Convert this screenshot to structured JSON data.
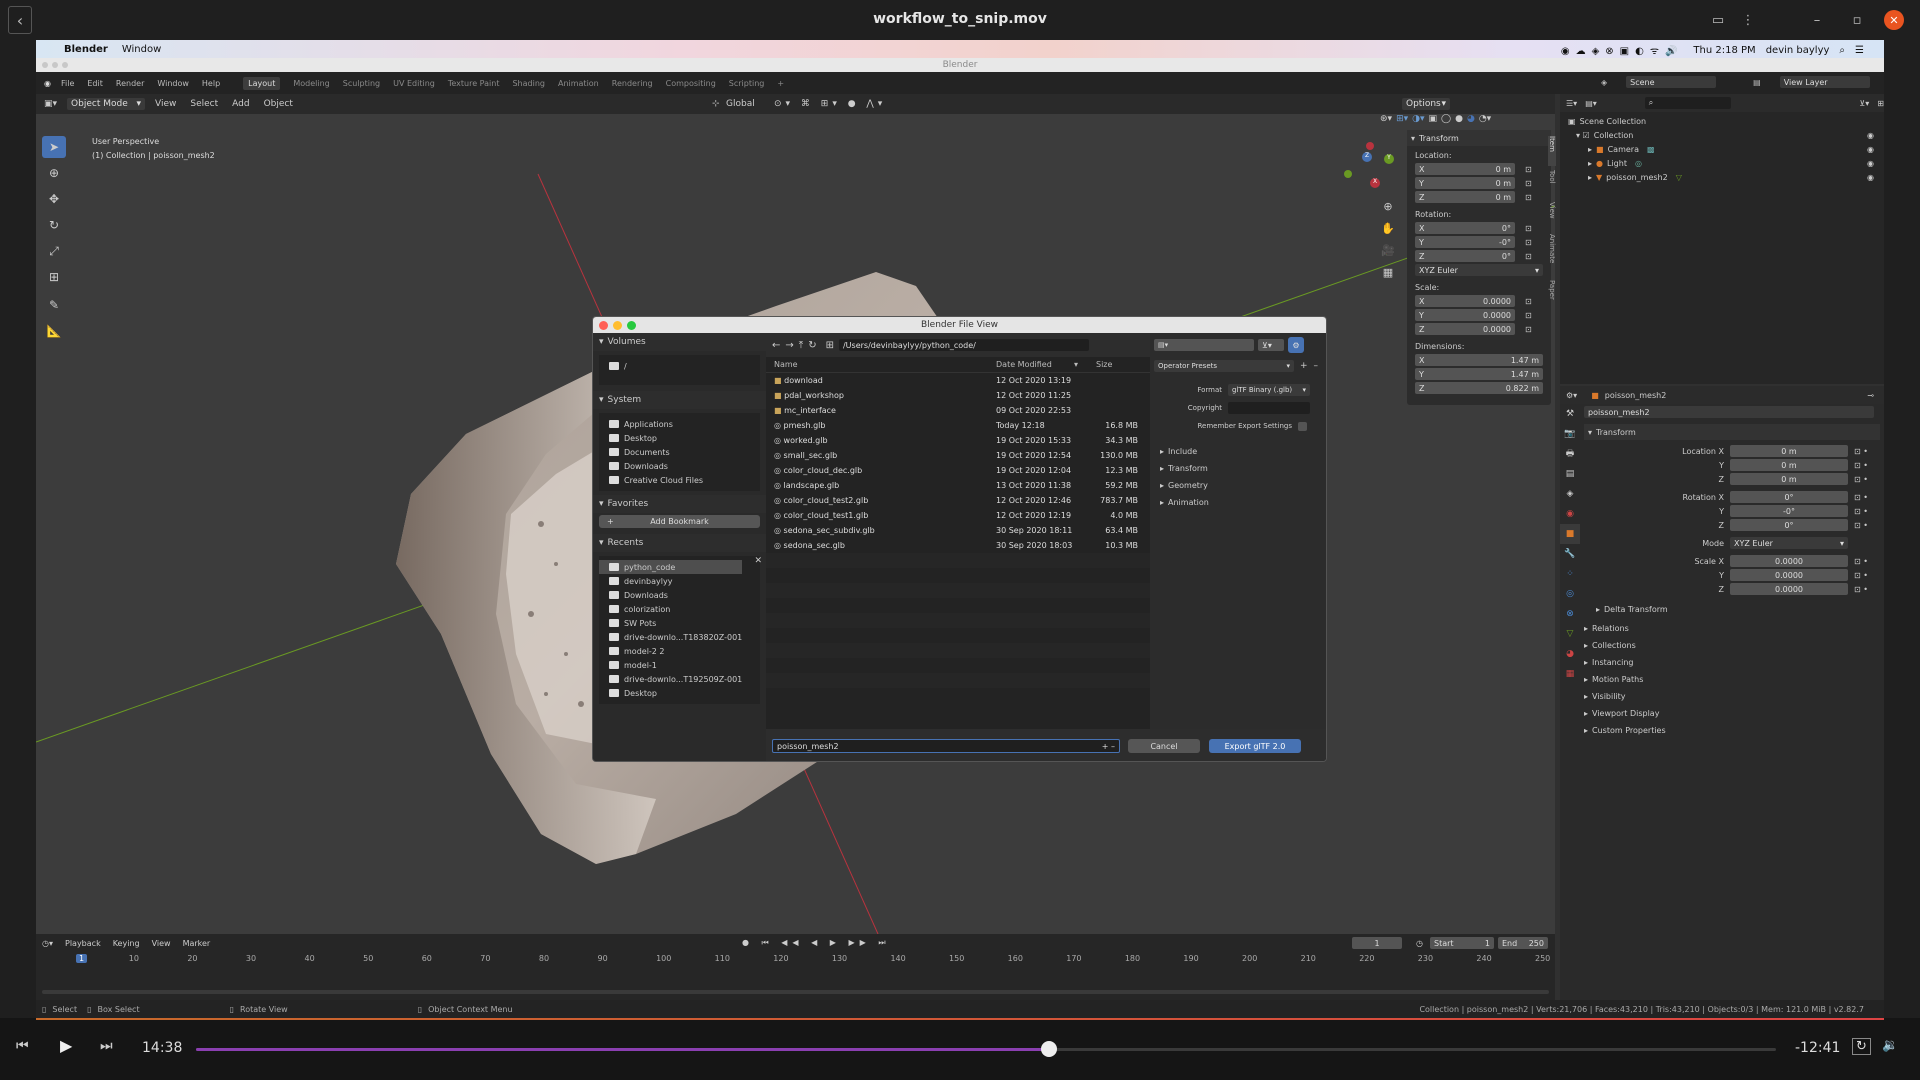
{
  "video": {
    "title": "workflow_to_snip.mov",
    "current_time": "14:38",
    "remaining_time": "-12:41",
    "progress": 0.54
  },
  "mac_menubar": {
    "app": "Blender",
    "menu": [
      "Window"
    ],
    "clock": "Thu 2:18 PM",
    "user": "devin baylyy"
  },
  "blender": {
    "window_title": "Blender",
    "menus": [
      "File",
      "Edit",
      "Render",
      "Window",
      "Help"
    ],
    "workspaces": [
      "Layout",
      "Modeling",
      "Sculpting",
      "UV Editing",
      "Texture Paint",
      "Shading",
      "Animation",
      "Rendering",
      "Compositing",
      "Scripting",
      "+"
    ],
    "active_workspace": "Layout",
    "scene": "Scene",
    "view_layer": "View Layer",
    "viewport": {
      "mode": "Object Mode",
      "menus": [
        "View",
        "Select",
        "Add",
        "Object"
      ],
      "transform_orientation": "Global",
      "options": "Options",
      "perspective": "User Perspective",
      "collection_info": "(1) Collection | poisson_mesh2"
    },
    "npanel": {
      "tabs": [
        "Item",
        "Tool",
        "View",
        "Animate",
        "Paper"
      ],
      "section": "Transform",
      "location_label": "Location:",
      "location": [
        {
          "axis": "X",
          "value": "0 m"
        },
        {
          "axis": "Y",
          "value": "0 m"
        },
        {
          "axis": "Z",
          "value": "0 m"
        }
      ],
      "rotation_label": "Rotation:",
      "rotation": [
        {
          "axis": "X",
          "value": "0°"
        },
        {
          "axis": "Y",
          "value": "-0°"
        },
        {
          "axis": "Z",
          "value": "0°"
        }
      ],
      "rotation_mode": "XYZ Euler",
      "scale_label": "Scale:",
      "scale": [
        {
          "axis": "X",
          "value": "0.0000"
        },
        {
          "axis": "Y",
          "value": "0.0000"
        },
        {
          "axis": "Z",
          "value": "0.0000"
        }
      ],
      "dimensions_label": "Dimensions:",
      "dimensions": [
        {
          "axis": "X",
          "value": "1.47 m"
        },
        {
          "axis": "Y",
          "value": "1.47 m"
        },
        {
          "axis": "Z",
          "value": "0.822 m"
        }
      ]
    },
    "outliner": {
      "root": "Scene Collection",
      "items": [
        "Collection",
        "Camera",
        "Light",
        "poisson_mesh2"
      ]
    },
    "properties": {
      "object_name": "poisson_mesh2",
      "object_field": "poisson_mesh2",
      "section": "Transform",
      "location": [
        {
          "label": "Location X",
          "value": "0 m"
        },
        {
          "label": "Y",
          "value": "0 m"
        },
        {
          "label": "Z",
          "value": "0 m"
        }
      ],
      "rotation": [
        {
          "label": "Rotation X",
          "value": "0°"
        },
        {
          "label": "Y",
          "value": "-0°"
        },
        {
          "label": "Z",
          "value": "0°"
        }
      ],
      "mode_label": "Mode",
      "mode": "XYZ Euler",
      "scale": [
        {
          "label": "Scale X",
          "value": "0.0000"
        },
        {
          "label": "Y",
          "value": "0.0000"
        },
        {
          "label": "Z",
          "value": "0.0000"
        }
      ],
      "subsections": [
        "Delta Transform"
      ],
      "panels": [
        "Relations",
        "Collections",
        "Instancing",
        "Motion Paths",
        "Visibility",
        "Viewport Display",
        "Custom Properties"
      ]
    },
    "timeline": {
      "menus": [
        "Playback",
        "Keying",
        "View",
        "Marker"
      ],
      "current_frame": "1",
      "start_label": "Start",
      "start": "1",
      "end_label": "End",
      "end": "250",
      "ticks": [
        "1",
        "10",
        "20",
        "30",
        "40",
        "50",
        "60",
        "70",
        "80",
        "90",
        "100",
        "110",
        "120",
        "130",
        "140",
        "150",
        "160",
        "170",
        "180",
        "190",
        "200",
        "210",
        "220",
        "230",
        "240",
        "250"
      ]
    },
    "statusbar": {
      "select": "Select",
      "box_select": "Box Select",
      "rotate_view": "Rotate View",
      "context_menu": "Object Context Menu",
      "stats": "Collection | poisson_mesh2 | Verts:21,706 | Faces:43,210 | Tris:43,210 | Objects:0/3 | Mem: 121.0 MiB | v2.82.7"
    }
  },
  "file_dialog": {
    "title": "Blender File View",
    "path": "/Users/devinbaylyy/python_code/",
    "sections": {
      "volumes": "Volumes",
      "volume_items": [
        "/"
      ],
      "system": "System",
      "system_items": [
        "Applications",
        "Desktop",
        "Documents",
        "Downloads",
        "Creative Cloud Files"
      ],
      "favorites": "Favorites",
      "add_bookmark": "Add Bookmark",
      "recents": "Recents",
      "recent_items": [
        "python_code",
        "devinbaylyy",
        "Downloads",
        "colorization",
        "SW Pots",
        "drive-downlo...T183820Z-001",
        "model-2 2",
        "model-1",
        "drive-downlo...T192509Z-001",
        "Desktop"
      ]
    },
    "columns": {
      "name": "Name",
      "date": "Date Modified",
      "size": "Size"
    },
    "files": [
      {
        "name": "download",
        "date": "12 Oct 2020 13:19",
        "size": "",
        "folder": true
      },
      {
        "name": "pdal_workshop",
        "date": "12 Oct 2020 11:25",
        "size": "",
        "folder": true
      },
      {
        "name": "mc_interface",
        "date": "09 Oct 2020 22:53",
        "size": "",
        "folder": true
      },
      {
        "name": "pmesh.glb",
        "date": "Today 12:18",
        "size": "16.8 MB",
        "folder": false
      },
      {
        "name": "worked.glb",
        "date": "19 Oct 2020 15:33",
        "size": "34.3 MB",
        "folder": false
      },
      {
        "name": "small_sec.glb",
        "date": "19 Oct 2020 12:54",
        "size": "130.0 MB",
        "folder": false
      },
      {
        "name": "color_cloud_dec.glb",
        "date": "19 Oct 2020 12:04",
        "size": "12.3 MB",
        "folder": false
      },
      {
        "name": "landscape.glb",
        "date": "13 Oct 2020 11:38",
        "size": "59.2 MB",
        "folder": false
      },
      {
        "name": "color_cloud_test2.glb",
        "date": "12 Oct 2020 12:46",
        "size": "783.7 MB",
        "folder": false
      },
      {
        "name": "color_cloud_test1.glb",
        "date": "12 Oct 2020 12:19",
        "size": "4.0 MB",
        "folder": false
      },
      {
        "name": "sedona_sec_subdiv.glb",
        "date": "30 Sep 2020 18:11",
        "size": "63.4 MB",
        "folder": false
      },
      {
        "name": "sedona_sec.glb",
        "date": "30 Sep 2020 18:03",
        "size": "10.3 MB",
        "folder": false
      }
    ],
    "operator_presets": "Operator Presets",
    "format_label": "Format",
    "format": "glTF Binary (.glb)",
    "copyright_label": "Copyright",
    "copyright": "",
    "remember_label": "Remember Export Settings",
    "option_groups": [
      "Include",
      "Transform",
      "Geometry",
      "Animation"
    ],
    "filename": "poisson_mesh2",
    "cancel": "Cancel",
    "export": "Export glTF 2.0"
  },
  "colors": {
    "accent": "#4772b3",
    "axis_red": "#b8333e",
    "axis_green": "#6a9a23",
    "progress_purple": "#8a3fb0"
  }
}
